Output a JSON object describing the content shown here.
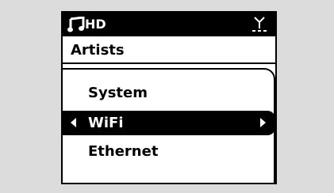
{
  "status_bar": {
    "source_icon": "music-note-icon",
    "source_label": "HD",
    "signal_icon": "antenna-signal-icon"
  },
  "breadcrumb": {
    "title": "Artists"
  },
  "menu": {
    "items": [
      {
        "label": "System",
        "selected": false
      },
      {
        "label": "WiFi",
        "selected": true
      },
      {
        "label": "Ethernet",
        "selected": false
      }
    ]
  },
  "colors": {
    "background": "#dcdcdc",
    "screen": "#ffffff",
    "highlight": "#000000",
    "highlight_text": "#ffffff"
  }
}
